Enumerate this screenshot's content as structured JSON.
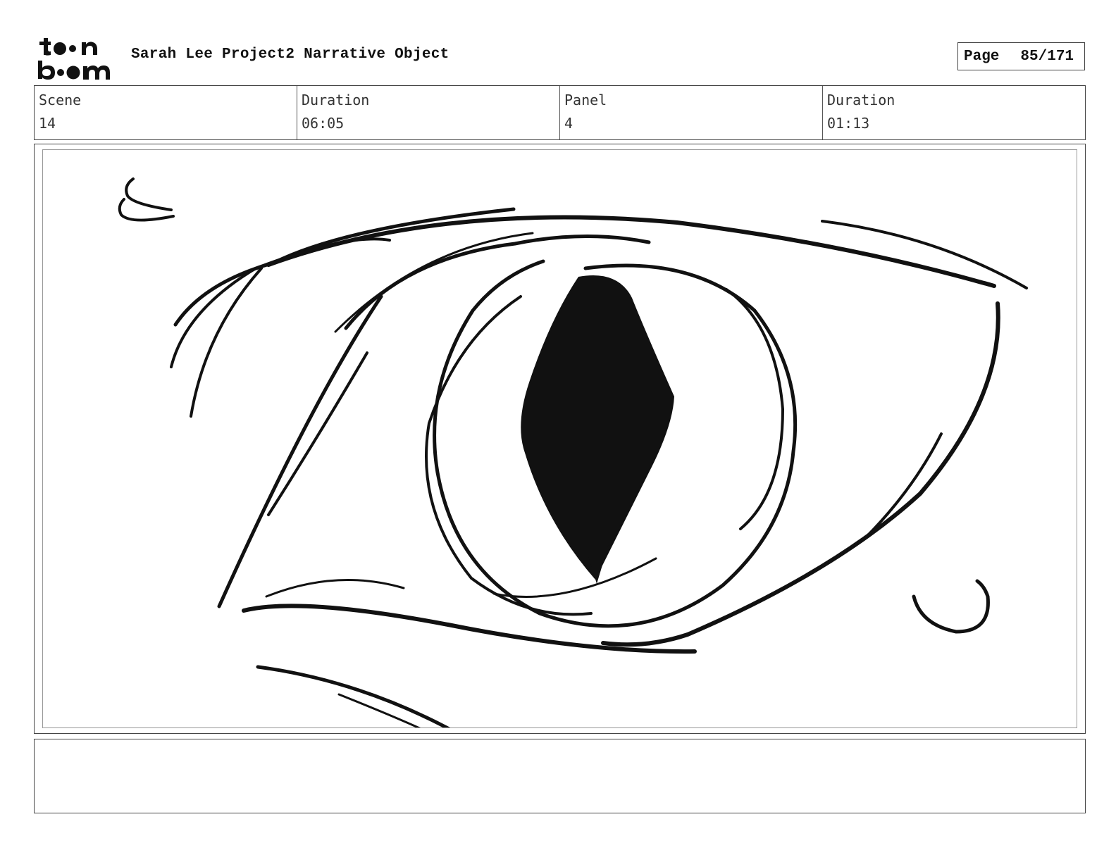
{
  "header": {
    "logo": {
      "line1": "toon",
      "line2": "boom"
    },
    "project_title": "Sarah Lee Project2 Narrative Object",
    "page_label": "Page",
    "page_value": "85/171"
  },
  "info": {
    "scene_label": "Scene",
    "scene_value": "14",
    "scene_duration_label": "Duration",
    "scene_duration_value": "06:05",
    "panel_label": "Panel",
    "panel_value": "4",
    "panel_duration_label": "Duration",
    "panel_duration_value": "01:13"
  },
  "panel": {
    "drawing": "eye-sketch-icon"
  },
  "notes": {
    "text": ""
  }
}
